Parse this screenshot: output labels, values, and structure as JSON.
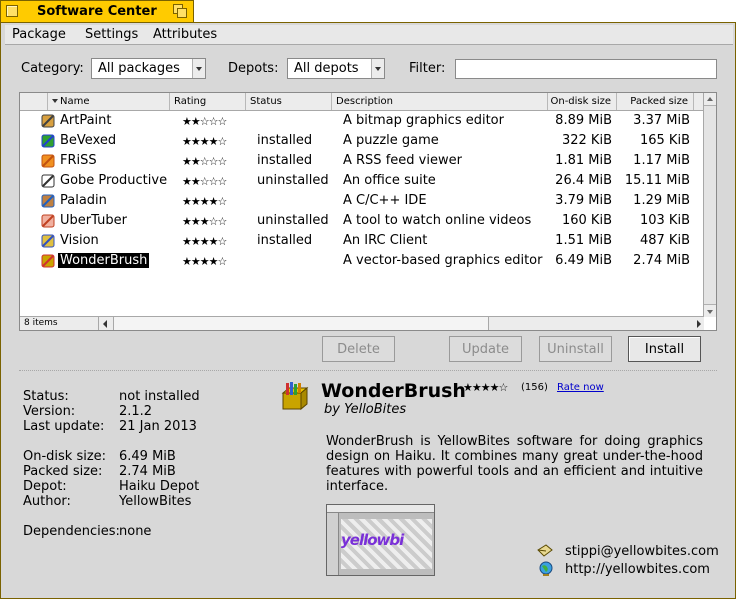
{
  "window": {
    "title": "Software Center"
  },
  "menubar": [
    "Package",
    "Settings",
    "Attributes"
  ],
  "filters": {
    "category_label": "Category:",
    "category_value": "All packages",
    "depots_label": "Depots:",
    "depots_value": "All depots",
    "filter_label": "Filter:",
    "filter_value": ""
  },
  "table": {
    "columns": [
      "Name",
      "Rating",
      "Status",
      "Description",
      "On-disk size",
      "Packed size"
    ],
    "rows": [
      {
        "name": "ArtPaint",
        "rating": "★★☆☆☆",
        "status": "",
        "description": "A bitmap graphics editor",
        "disk": "8.89 MiB",
        "packed": "3.37 MiB",
        "icon": "artpaint-icon"
      },
      {
        "name": "BeVexed",
        "rating": "★★★★☆",
        "status": "installed",
        "description": "A puzzle game",
        "disk": "322 KiB",
        "packed": "165 KiB",
        "icon": "bevexed-icon"
      },
      {
        "name": "FRiSS",
        "rating": "★★☆☆☆",
        "status": "installed",
        "description": "A RSS feed viewer",
        "disk": "1.81 MiB",
        "packed": "1.17 MiB",
        "icon": "friss-icon"
      },
      {
        "name": "Gobe Productive",
        "rating": "★★☆☆☆",
        "status": "uninstalled",
        "description": "An office suite",
        "disk": "26.4 MiB",
        "packed": "15.11 MiB",
        "icon": "gobe-icon"
      },
      {
        "name": "Paladin",
        "rating": "★★★★☆",
        "status": "",
        "description": "A C/C++ IDE",
        "disk": "3.79 MiB",
        "packed": "1.29 MiB",
        "icon": "paladin-icon"
      },
      {
        "name": "UberTuber",
        "rating": "★★★☆☆",
        "status": "uninstalled",
        "description": "A tool to watch online videos",
        "disk": "160 KiB",
        "packed": "103 KiB",
        "icon": "ubertuber-icon"
      },
      {
        "name": "Vision",
        "rating": "★★★★☆",
        "status": "installed",
        "description": "An IRC Client",
        "disk": "1.51 MiB",
        "packed": "487 KiB",
        "icon": "vision-icon"
      },
      {
        "name": "WonderBrush",
        "rating": "★★★★☆",
        "status": "",
        "description": "A vector-based graphics editor",
        "disk": "6.49 MiB",
        "packed": "2.74 MiB",
        "icon": "wonderbrush-icon"
      }
    ],
    "selected_index": 7,
    "item_count": "8 items"
  },
  "buttons": {
    "delete": "Delete",
    "update": "Update",
    "uninstall": "Uninstall",
    "install": "Install"
  },
  "details": {
    "labels": {
      "status": "Status:",
      "version": "Version:",
      "last_update": "Last update:",
      "disk": "On-disk size:",
      "packed": "Packed size:",
      "depot": "Depot:",
      "author": "Author:",
      "deps": "Dependencies:"
    },
    "values": {
      "status": "not installed",
      "version": "2.1.2",
      "last_update": "21 Jan 2013",
      "disk": "6.49 MiB",
      "packed": "2.74 MiB",
      "depot": "Haiku Depot",
      "author": "YellowBites",
      "deps": "none"
    }
  },
  "app": {
    "name": "WonderBrush",
    "rating": "★★★★☆",
    "rating_count": "(156)",
    "rate_now": "Rate now",
    "publisher": "by YelloBites",
    "description": "WonderBrush is YellowBites software for doing graphics design on Haiku. It combines many great under-the-hood features with powerful tools and an efficient and intuitive interface.",
    "screenshot_text": "yellowbi",
    "email": "stippi@yellowbites.com",
    "website": "http://yellowbites.com"
  },
  "colors": {
    "tab": "#ffcb00",
    "window_bg": "#d8d8d8",
    "selection": "#000000"
  }
}
